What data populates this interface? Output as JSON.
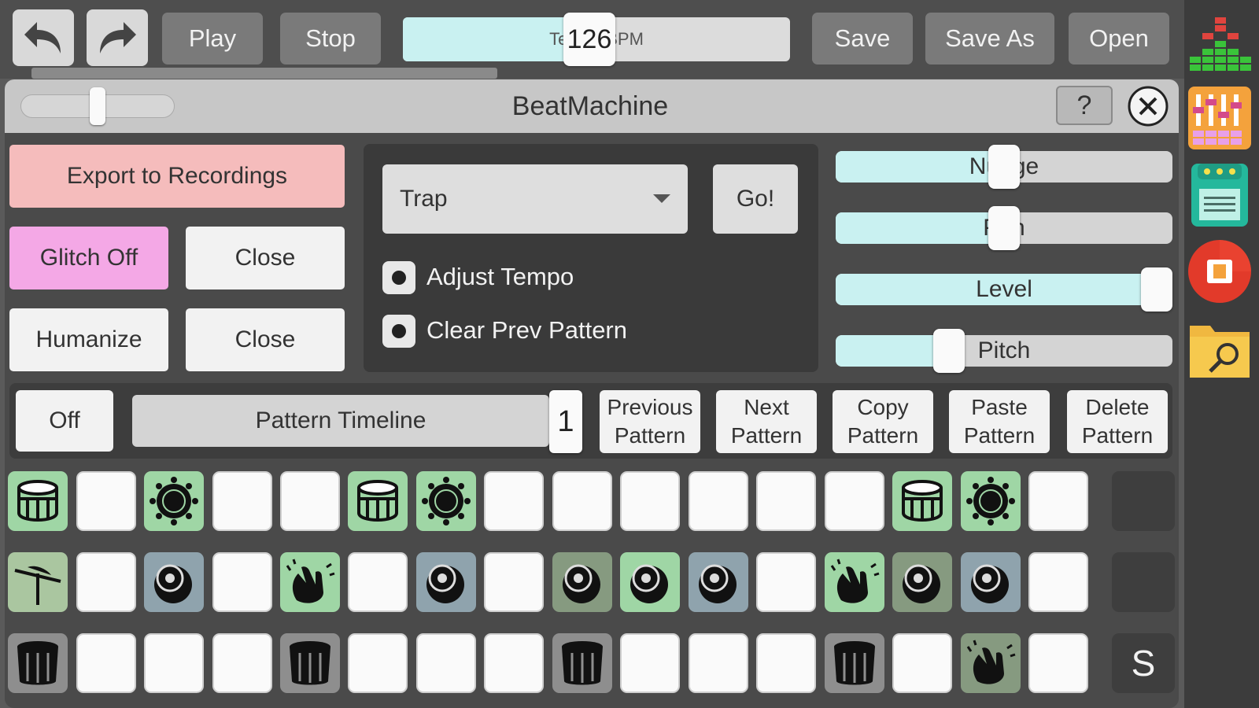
{
  "toolbar": {
    "play_label": "Play",
    "stop_label": "Stop",
    "save_label": "Save",
    "save_as_label": "Save As",
    "open_label": "Open",
    "tempo_label": "Tempo BPM",
    "tempo_value": "126",
    "tempo_fraction": 0.46
  },
  "window": {
    "title": "BeatMachine",
    "help_label": "?",
    "slider_fraction": 0.48
  },
  "left_buttons": {
    "export_label": "Export to Recordings",
    "glitch_label": "Glitch Off",
    "close1_label": "Close",
    "humanize_label": "Humanize",
    "close2_label": "Close"
  },
  "generator": {
    "style_value": "Trap",
    "go_label": "Go!",
    "adjust_tempo_label": "Adjust Tempo",
    "clear_prev_label": "Clear Prev Pattern"
  },
  "sliders": [
    {
      "label": "Nudge",
      "fraction": 0.5
    },
    {
      "label": "Pan",
      "fraction": 0.5
    },
    {
      "label": "Level",
      "fraction": 1.0
    },
    {
      "label": "Pitch",
      "fraction": 0.32
    }
  ],
  "pattern": {
    "off_label": "Off",
    "timeline_label": "Pattern Timeline",
    "timeline_value": "1",
    "prev_label": "Previous\nPattern",
    "next_label": "Next\nPattern",
    "copy_label": "Copy\nPattern",
    "paste_label": "Paste\nPattern",
    "delete_label": "Delete\nPattern"
  },
  "colors": {
    "accent_cyan": "#c9f1f1",
    "export_pink": "#f5bcbc",
    "glitch_pink": "#f4a8e6",
    "cell_green": "#9fd6a5",
    "cell_blue": "#8fa3ad"
  },
  "grid": {
    "s_label": "S",
    "rows": [
      [
        "snare-icon:green",
        "empty",
        "tom-icon:green",
        "empty",
        "empty",
        "snare-icon:green",
        "tom-icon:green",
        "empty",
        "empty",
        "empty",
        "empty",
        "empty",
        "empty",
        "snare-icon:green",
        "tom-icon:green",
        "empty",
        "dark"
      ],
      [
        "cymbal-icon:sage",
        "empty",
        "kick-icon:blue",
        "empty",
        "clap-icon:green",
        "empty",
        "kick-icon:blue",
        "empty",
        "kick-icon:dsage",
        "kick-icon:green",
        "kick-icon:blue",
        "empty",
        "clap-icon:green",
        "kick-icon:dsage",
        "kick-icon:blue",
        "empty",
        "dark"
      ],
      [
        "bass-drum-icon:gray",
        "empty",
        "empty",
        "empty",
        "bass-drum-icon:gray",
        "empty",
        "empty",
        "empty",
        "bass-drum-icon:gray",
        "empty",
        "empty",
        "empty",
        "bass-drum-icon:gray",
        "empty",
        "clap-icon:dsage",
        "empty",
        "s"
      ]
    ]
  },
  "sidebar_icons": [
    "equalizer-icon",
    "mixer-icon",
    "sampler-icon",
    "record-icon",
    "file-browser-icon"
  ]
}
